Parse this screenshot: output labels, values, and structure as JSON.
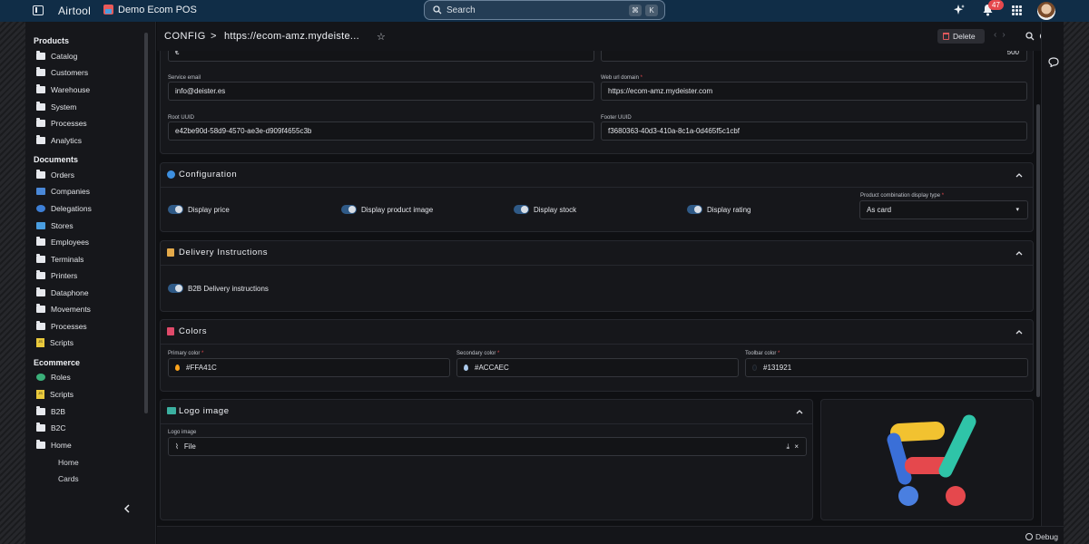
{
  "topbar": {
    "app_name": "Airtool",
    "store_name": "Demo Ecom POS",
    "search_placeholder": "Search",
    "search_kbd_1": "⌘",
    "search_kbd_2": "K",
    "notifications_count": "47"
  },
  "sidebar": {
    "sections": [
      {
        "title": "Products",
        "items": [
          "Catalog",
          "Customers",
          "Warehouse",
          "System",
          "Processes",
          "Analytics"
        ]
      },
      {
        "title": "Documents",
        "items": [
          "Orders",
          "Companies",
          "Delegations",
          "Stores",
          "Employees",
          "Terminals",
          "Printers",
          "Dataphone",
          "Movements",
          "Processes",
          "Scripts"
        ]
      },
      {
        "title": "Ecommerce",
        "items": [
          "Roles",
          "Scripts",
          "B2B",
          "B2C",
          "Home"
        ]
      }
    ],
    "home_subitems": [
      "Home",
      "Cards"
    ]
  },
  "header": {
    "breadcrumb_root": "CONFIG",
    "breadcrumb_sep": ">",
    "breadcrumb_current": "https://ecom-amz.mydeiste...",
    "delete_label": "Delete"
  },
  "form": {
    "top_left_value": "€",
    "top_right_value": "500",
    "service_email_label": "Service email",
    "service_email_value": "info@deister.es",
    "web_url_label": "Web url domain",
    "web_url_value": "https://ecom-amz.mydeister.com",
    "root_uuid_label": "Root UUID",
    "root_uuid_value": "e42be90d-58d9-4570-ae3e-d909f4655c3b",
    "footer_uuid_label": "Footer UUID",
    "footer_uuid_value": "f3680363-40d3-410a-8c1a-0d465f5c1cbf"
  },
  "configuration": {
    "title": "Configuration",
    "toggles": [
      "Display price",
      "Display product image",
      "Display stock",
      "Display rating"
    ],
    "combo_label": "Product combination display type",
    "combo_value": "As card"
  },
  "delivery": {
    "title": "Delivery Instructions",
    "toggle": "B2B Delivery instructions"
  },
  "colors": {
    "title": "Colors",
    "primary_label": "Primary color",
    "primary_value": "#FFA41C",
    "secondary_label": "Secondary color",
    "secondary_value": "#ACCAEC",
    "toolbar_label": "Toolbar color",
    "toolbar_value": "#131921",
    "accent": "#FFA41C",
    "secondary": "#ACCAEC",
    "toolbar": "#131921"
  },
  "logo": {
    "title": "Logo image",
    "field_label": "Logo image",
    "field_value": "File"
  },
  "footer": {
    "debug_label": "Debug"
  }
}
